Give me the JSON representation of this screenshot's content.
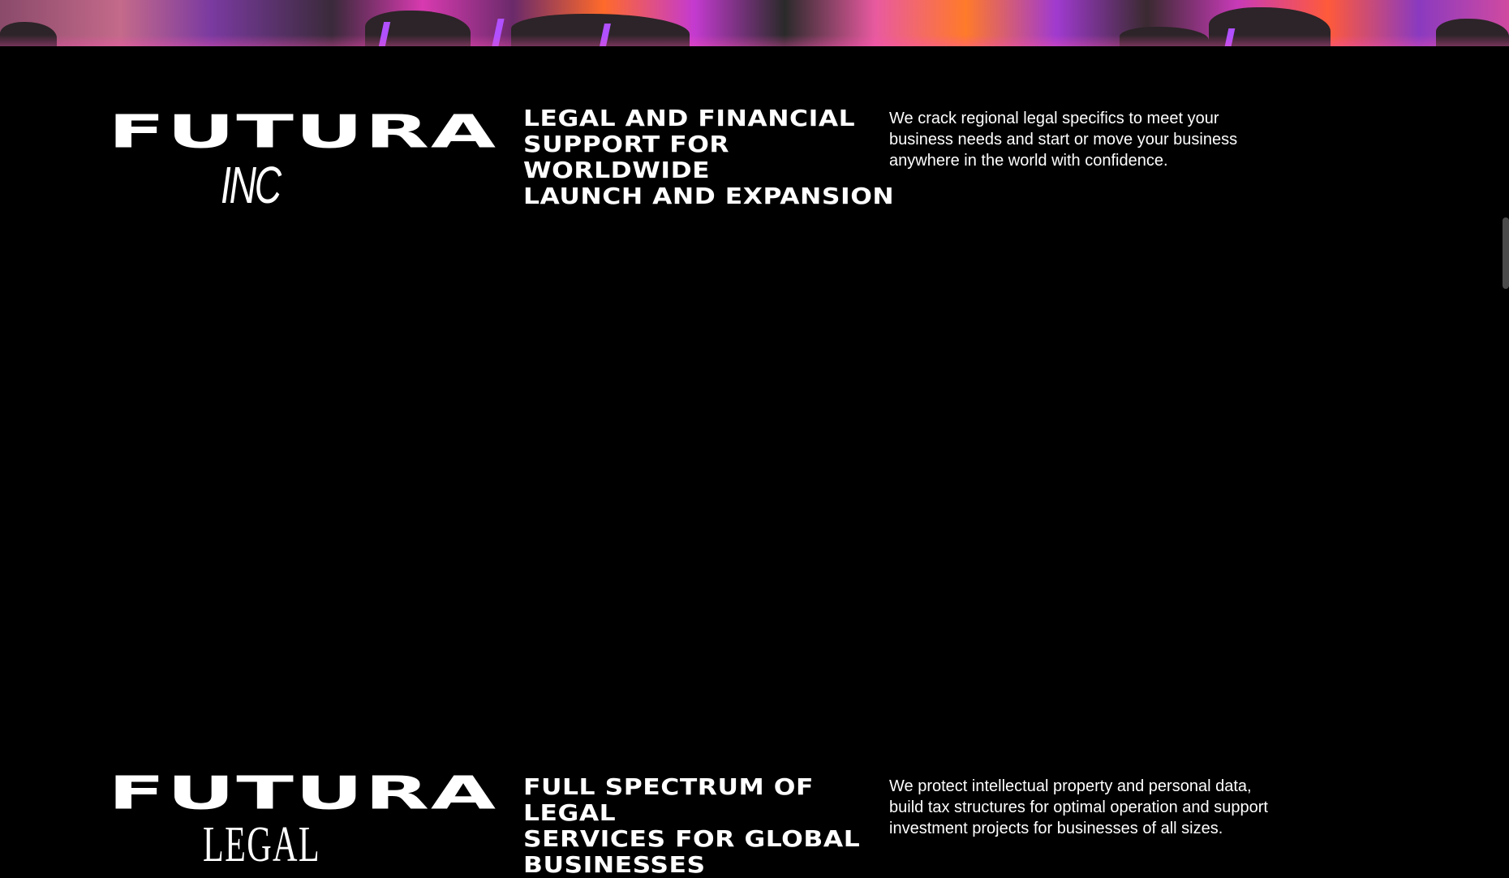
{
  "hero": {
    "icon": "landscape-image",
    "colors": [
      "#c43ad0",
      "#ff6a2a",
      "#d83ab0"
    ]
  },
  "sections": [
    {
      "logo_word": "FUTURA",
      "logo_sub": "INC",
      "heading_lines": [
        "LEGAL AND FINANCIAL",
        "SUPPORT FOR WORLDWIDE",
        "LAUNCH AND EXPANSION"
      ],
      "description": "We crack regional legal specifics to meet your business needs and start or move your business anywhere in the world with confidence."
    },
    {
      "logo_word": "FUTURA",
      "logo_sub": "LEGAL",
      "heading_lines": [
        "FULL SPECTRUM OF LEGAL",
        "SERVICES FOR GLOBAL",
        "BUSINESSES"
      ],
      "description": "We protect intellectual property and personal data, build tax structures for optimal operation and support investment projects for businesses of all sizes."
    }
  ],
  "theme": {
    "background": "#000000",
    "text": "#ffffff"
  }
}
